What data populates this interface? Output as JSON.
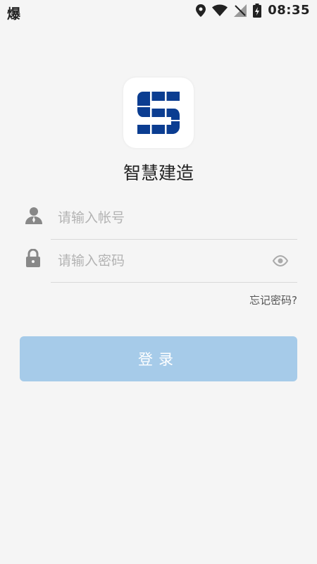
{
  "status_bar": {
    "left_glyph": "爆",
    "time": "08:35",
    "icons": [
      "location-icon",
      "wifi-icon",
      "no-signal-icon",
      "battery-charging-icon"
    ]
  },
  "app": {
    "logo_icon": "s-grid-logo-icon",
    "logo_color": "#0b3d91",
    "name": "智慧建造"
  },
  "form": {
    "account": {
      "placeholder": "请输入帐号",
      "value": "",
      "icon": "user-icon"
    },
    "password": {
      "placeholder": "请输入密码",
      "value": "",
      "icon": "lock-icon",
      "toggle_icon": "eye-icon"
    },
    "forgot_label": "忘记密码?",
    "login_label": "登录",
    "login_color": "#a6cbe9"
  }
}
